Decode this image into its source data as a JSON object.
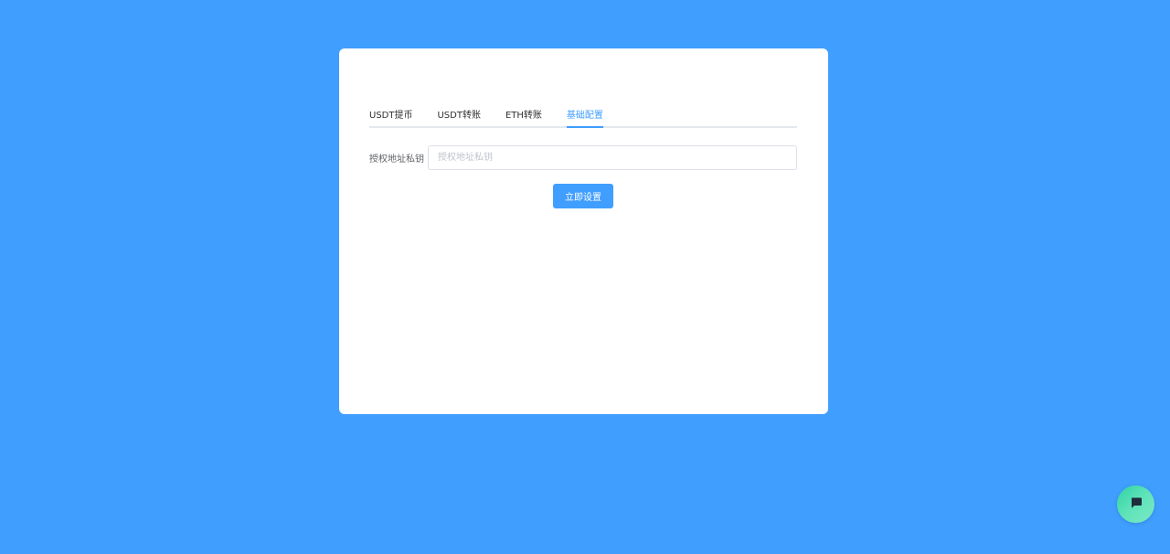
{
  "colors": {
    "background": "#409eff",
    "accent": "#409eff",
    "card": "#ffffff",
    "chat_button": "#2ed3a6"
  },
  "tabs": [
    {
      "label": "USDT提币",
      "active": false
    },
    {
      "label": "USDT转账",
      "active": false
    },
    {
      "label": "ETH转账",
      "active": false
    },
    {
      "label": "基础配置",
      "active": true
    }
  ],
  "form": {
    "label": "授权地址私钥",
    "value": "",
    "placeholder": "授权地址私钥",
    "submit_label": "立即设置"
  },
  "chat_button": {
    "icon": "chat-bubble-icon"
  }
}
